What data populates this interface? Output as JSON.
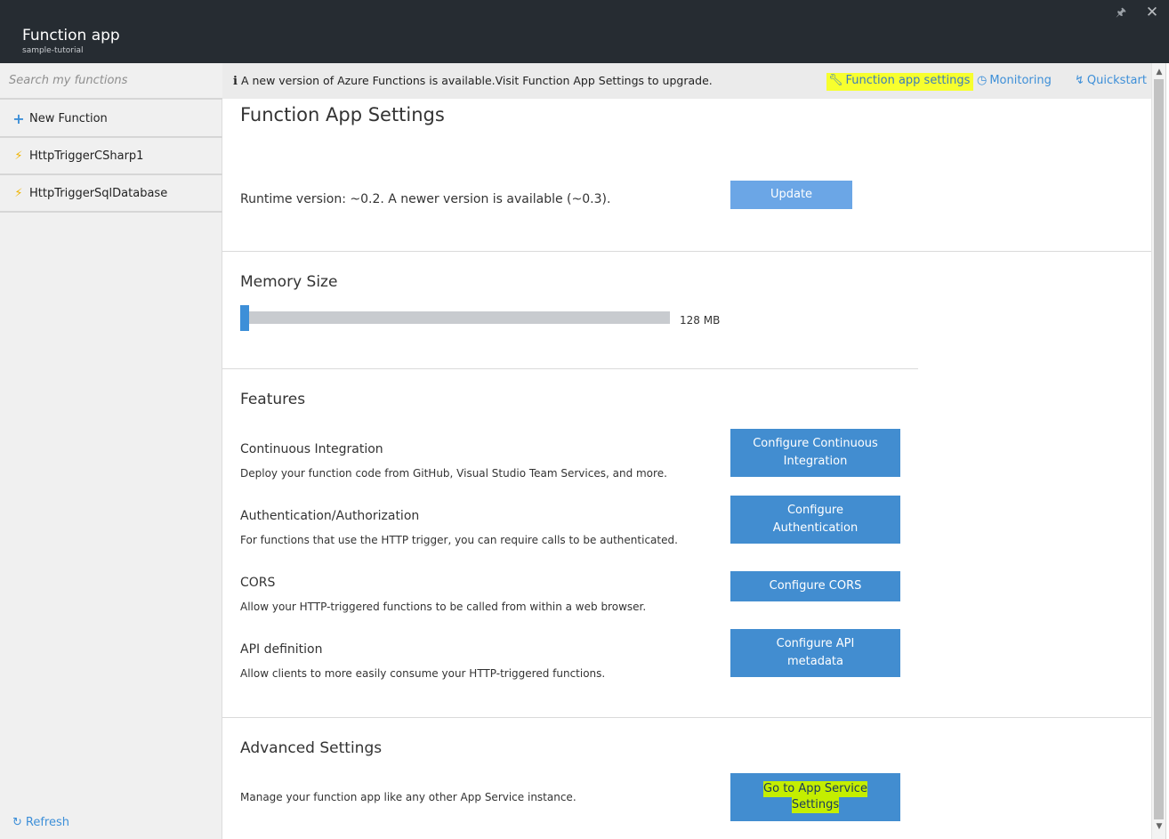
{
  "titlebar": {
    "title": "Function app",
    "subtitle": "sample-tutorial",
    "pin_icon": "pin-icon",
    "close_icon": "close-icon"
  },
  "sidebar": {
    "search_placeholder": "Search my functions",
    "items": [
      {
        "label": "New Function",
        "icon": "plus-icon"
      },
      {
        "label": "HttpTriggerCSharp1",
        "icon": "function-bolt-icon"
      },
      {
        "label": "HttpTriggerSqlDatabase",
        "icon": "function-bolt-icon"
      }
    ],
    "refresh_label": "Refresh"
  },
  "notice": {
    "icon": "info-icon",
    "message": "A new version of Azure Functions is available.Visit Function App Settings to upgrade.",
    "links": [
      {
        "label": "Function app settings",
        "icon": "wrench-icon",
        "highlighted": true
      },
      {
        "label": "Monitoring",
        "icon": "clock-icon"
      },
      {
        "label": "Quickstart",
        "icon": "bolt-icon"
      }
    ]
  },
  "main": {
    "title": "Function App Settings",
    "runtime": {
      "text": "Runtime version: ~0.2. A newer version is available (~0.3).",
      "button": "Update"
    },
    "memory": {
      "heading": "Memory Size",
      "value_label": "128 MB",
      "fill_fraction": 0.0
    },
    "features": {
      "heading": "Features",
      "items": [
        {
          "title": "Continuous Integration",
          "desc": "Deploy your function code from GitHub, Visual Studio Team Services, and more.",
          "button_line1": "Configure Continuous",
          "button_line2": "Integration"
        },
        {
          "title": "Authentication/Authorization",
          "desc": "For functions that use the HTTP trigger, you can require calls to be authenticated.",
          "button_line1": "Configure",
          "button_line2": "Authentication"
        },
        {
          "title": "CORS",
          "desc": "Allow your HTTP-triggered functions to be called from within a web browser.",
          "button_line1": "Configure CORS",
          "button_line2": ""
        },
        {
          "title": "API definition",
          "desc": "Allow clients to more easily consume your HTTP-triggered functions.",
          "button_line1": "Configure API",
          "button_line2": "metadata"
        }
      ]
    },
    "advanced": {
      "heading": "Advanced Settings",
      "desc": "Manage your function app like any other App Service instance.",
      "button_line1": "Go to App Service",
      "button_line2": "Settings"
    }
  },
  "colors": {
    "titlebar": "#262c32",
    "accent": "#428dd0",
    "highlight": "#f7ff2e",
    "button_highlight": "#c4ee00"
  }
}
